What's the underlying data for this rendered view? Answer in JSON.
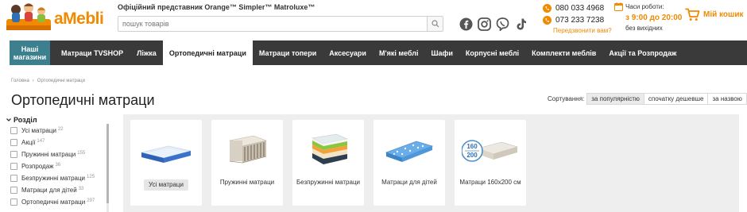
{
  "header": {
    "brand": "aMebli",
    "tagline": "Офіційний представник Orange™ Simpler™ Matroluxe™",
    "search_placeholder": "пошук товарів",
    "phones": [
      "080 033 4968",
      "073 233 7238"
    ],
    "callback": "Передзвонити вам?",
    "hours_title": "Часи роботи:",
    "hours_time": "з 9:00 до 20:00",
    "hours_days": "без вихідних",
    "cart_label": "Мій кошик",
    "social_icons": [
      "facebook-icon",
      "instagram-icon",
      "viber-icon",
      "tiktok-icon"
    ],
    "accent_color": "#f08a00"
  },
  "nav": {
    "shops": "Наші магазини",
    "items": [
      "Матраци TVSHOP",
      "Ліжка",
      "Ортопедичні матраци",
      "Матраци топери",
      "Аксесуари",
      "М'які меблі",
      "Шафи",
      "Корпусні меблі",
      "Комплекти меблів",
      "Акції та Розпродаж"
    ],
    "active_index": 2,
    "shops_color": "#3c7f8f",
    "bar_color": "#3a3a3a"
  },
  "breadcrumb": [
    "Головна",
    "Ортопедичні матраци"
  ],
  "page_title": "Ортопедичні матраци",
  "sort": {
    "label": "Сортування:",
    "options": [
      "за популярністю",
      "спочатку дешевше",
      "за назвою"
    ],
    "active_index": 0
  },
  "filters": {
    "heading": "Розділ",
    "items": [
      {
        "label": "Усі матраци",
        "count": "22"
      },
      {
        "label": "Акції",
        "count": "147"
      },
      {
        "label": "Пружинні матраци",
        "count": "155"
      },
      {
        "label": "Розпродаж",
        "count": "36"
      },
      {
        "label": "Безпружинні матраци",
        "count": "125"
      },
      {
        "label": "Матраци для дітей",
        "count": "33"
      },
      {
        "label": "Ортопедичні матраци",
        "count": "297"
      }
    ]
  },
  "categories": [
    {
      "label": "Усі матраци",
      "image": "mattress-image"
    },
    {
      "label": "Пружинні матраци",
      "image": "spring-mattress-image"
    },
    {
      "label": "Безпружинні матраци",
      "image": "springless-mattress-image"
    },
    {
      "label": "Матраци для дітей",
      "image": "kids-mattress-image"
    },
    {
      "label": "Матраци 160x200 см",
      "image": "mattress-160x200-image",
      "badge": [
        "160",
        "200"
      ]
    }
  ]
}
